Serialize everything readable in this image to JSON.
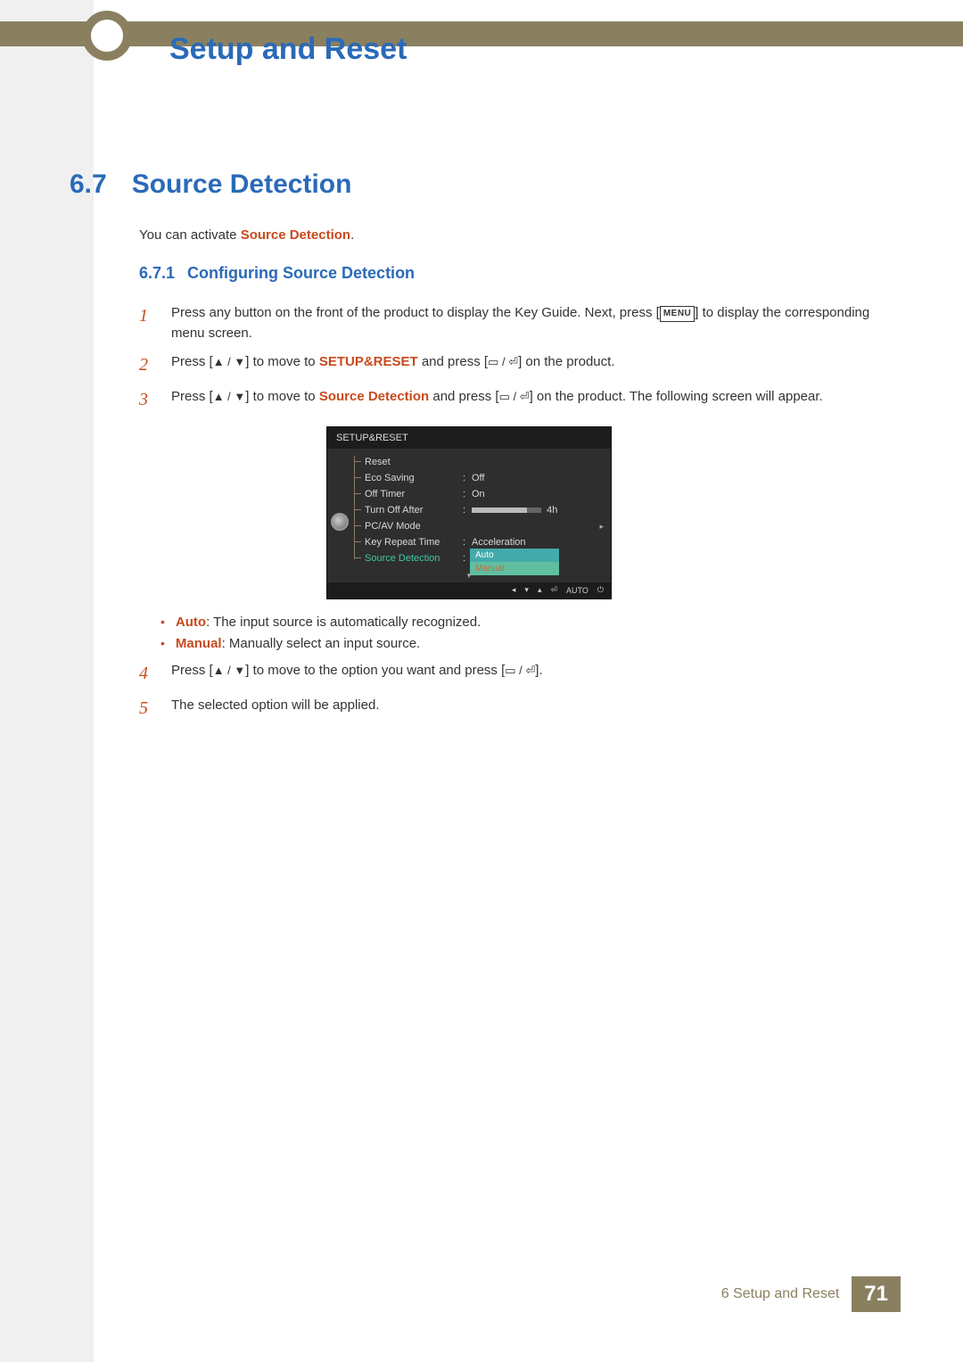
{
  "header": {
    "chapter_title": "Setup and Reset"
  },
  "section": {
    "number": "6.7",
    "title": "Source Detection"
  },
  "intro": {
    "prefix": "You can activate ",
    "emph": "Source Detection",
    "suffix": "."
  },
  "subsection": {
    "number": "6.7.1",
    "title": "Configuring Source Detection"
  },
  "steps": {
    "s1": {
      "num": "1",
      "pre": "Press any button on the front of the product to display the Key Guide. Next, press [",
      "menu": "MENU",
      "post": "] to display the corresponding menu screen."
    },
    "s2": {
      "num": "2",
      "a": "Press [",
      "updown": "▲ / ▼",
      "b": "] to move to ",
      "target": "SETUP&RESET",
      "c": " and press [",
      "enter": "▭ / ⏎",
      "d": "] on the product."
    },
    "s3": {
      "num": "3",
      "a": "Press [",
      "updown": "▲ / ▼",
      "b": "] to move to ",
      "target": "Source Detection",
      "c": " and press [",
      "enter": "▭ / ⏎",
      "d": "] on the product. The following screen will appear."
    },
    "s4": {
      "num": "4",
      "a": "Press [",
      "updown": "▲ / ▼",
      "b": "] to move to the option you want and press [",
      "enter": "▭ / ⏎",
      "c": "]."
    },
    "s5": {
      "num": "5",
      "text": "The selected option will be applied."
    }
  },
  "osd": {
    "title": "SETUP&RESET",
    "rows": {
      "reset": {
        "label": "Reset",
        "value": ""
      },
      "eco": {
        "label": "Eco Saving",
        "value": "Off"
      },
      "offtimer": {
        "label": "Off Timer",
        "value": "On"
      },
      "turnoff": {
        "label": "Turn Off After",
        "value": "4h"
      },
      "pcav": {
        "label": "PC/AV Mode",
        "value": ""
      },
      "keyrep": {
        "label": "Key Repeat Time",
        "value": "Acceleration"
      },
      "srcdet": {
        "label": "Source Detection",
        "value": "Auto"
      }
    },
    "dropdown": {
      "opt1": "Auto",
      "opt2": "Manual"
    },
    "footer_auto": "AUTO"
  },
  "bullets": {
    "auto": {
      "label": "Auto",
      "text": ": The input source is automatically recognized."
    },
    "manual": {
      "label": "Manual",
      "text": ": Manually select an input source."
    }
  },
  "footer": {
    "chapter": "6 Setup and Reset",
    "page": "71"
  }
}
